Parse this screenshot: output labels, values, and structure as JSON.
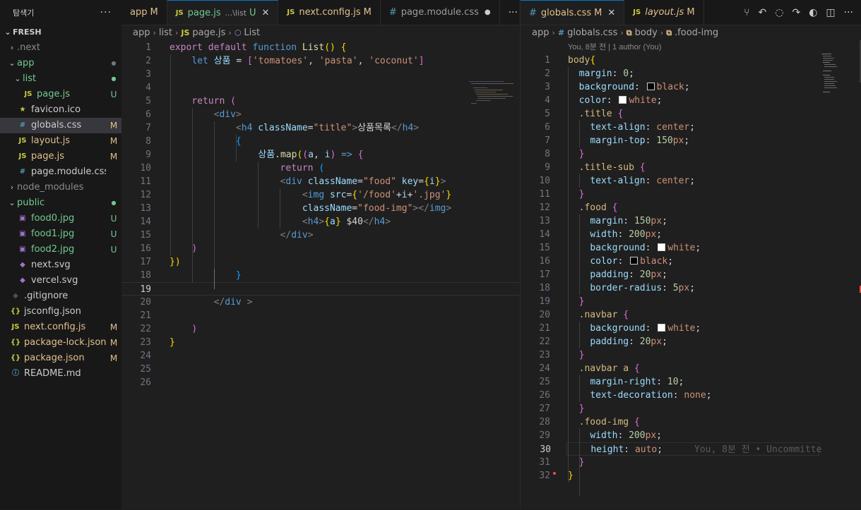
{
  "explorer": {
    "title": "탐색기",
    "more": "···",
    "root": "FRESH",
    "items": [
      {
        "label": ".next",
        "chev": "›",
        "indent": 0,
        "icon": "",
        "iconType": "",
        "status": "",
        "statusType": "dot-grey",
        "color": "grey"
      },
      {
        "label": "app",
        "chev": "⌄",
        "indent": 0,
        "icon": "",
        "iconType": "",
        "status": "●",
        "statusType": "dot-grey",
        "color": "green"
      },
      {
        "label": "list",
        "chev": "⌄",
        "indent": 1,
        "icon": "",
        "iconType": "",
        "status": "●",
        "statusType": "dot-green",
        "color": "green"
      },
      {
        "label": "page.js",
        "chev": "",
        "indent": 2,
        "icon": "JS",
        "iconType": "js",
        "status": "U",
        "statusType": "u",
        "color": "green"
      },
      {
        "label": "favicon.ico",
        "chev": "",
        "indent": 1,
        "icon": "★",
        "iconType": "star",
        "status": "",
        "statusType": "",
        "color": "plain"
      },
      {
        "label": "globals.css",
        "chev": "",
        "indent": 1,
        "icon": "#",
        "iconType": "hash",
        "status": "M",
        "statusType": "m",
        "color": "plain",
        "selected": true
      },
      {
        "label": "layout.js",
        "chev": "",
        "indent": 1,
        "icon": "JS",
        "iconType": "js",
        "status": "M",
        "statusType": "m",
        "color": "yellow"
      },
      {
        "label": "page.js",
        "chev": "",
        "indent": 1,
        "icon": "JS",
        "iconType": "js",
        "status": "M",
        "statusType": "m",
        "color": "yellow"
      },
      {
        "label": "page.module.css",
        "chev": "",
        "indent": 1,
        "icon": "#",
        "iconType": "hash",
        "status": "",
        "statusType": "",
        "color": "plain"
      },
      {
        "label": "node_modules",
        "chev": "›",
        "indent": 0,
        "icon": "",
        "iconType": "",
        "status": "",
        "statusType": "",
        "color": "grey"
      },
      {
        "label": "public",
        "chev": "⌄",
        "indent": 0,
        "icon": "",
        "iconType": "",
        "status": "●",
        "statusType": "dot-green",
        "color": "green"
      },
      {
        "label": "food0.jpg",
        "chev": "",
        "indent": 1,
        "icon": "▣",
        "iconType": "img",
        "status": "U",
        "statusType": "u",
        "color": "green"
      },
      {
        "label": "food1.jpg",
        "chev": "",
        "indent": 1,
        "icon": "▣",
        "iconType": "img",
        "status": "U",
        "statusType": "u",
        "color": "green"
      },
      {
        "label": "food2.jpg",
        "chev": "",
        "indent": 1,
        "icon": "▣",
        "iconType": "img",
        "status": "U",
        "statusType": "u",
        "color": "green"
      },
      {
        "label": "next.svg",
        "chev": "",
        "indent": 1,
        "icon": "◆",
        "iconType": "svg",
        "status": "",
        "statusType": "",
        "color": "plain"
      },
      {
        "label": "vercel.svg",
        "chev": "",
        "indent": 1,
        "icon": "◆",
        "iconType": "svg",
        "status": "",
        "statusType": "",
        "color": "plain"
      },
      {
        "label": ".gitignore",
        "chev": "",
        "indent": 0,
        "icon": "◆",
        "iconType": "git",
        "status": "",
        "statusType": "",
        "color": "plain"
      },
      {
        "label": "jsconfig.json",
        "chev": "",
        "indent": 0,
        "icon": "{}",
        "iconType": "json",
        "status": "",
        "statusType": "",
        "color": "plain"
      },
      {
        "label": "next.config.js",
        "chev": "",
        "indent": 0,
        "icon": "JS",
        "iconType": "js",
        "status": "M",
        "statusType": "m",
        "color": "yellow"
      },
      {
        "label": "package-lock.json",
        "chev": "",
        "indent": 0,
        "icon": "{}",
        "iconType": "json",
        "status": "M",
        "statusType": "m",
        "color": "yellow"
      },
      {
        "label": "package.json",
        "chev": "",
        "indent": 0,
        "icon": "{}",
        "iconType": "json",
        "status": "M",
        "statusType": "m",
        "color": "yellow"
      },
      {
        "label": "README.md",
        "chev": "",
        "indent": 0,
        "icon": "ⓘ",
        "iconType": "info",
        "status": "",
        "statusType": "",
        "color": "plain"
      }
    ]
  },
  "left_editor": {
    "tabs": [
      {
        "label": "app",
        "status": "M",
        "kind": "plain"
      },
      {
        "label": "page.js",
        "sub": "...\\list",
        "status": "U",
        "kind": "js",
        "active": true,
        "close": "✕"
      },
      {
        "label": "next.config.js",
        "status": "M",
        "kind": "js"
      },
      {
        "label": "page.module.css",
        "status": "●",
        "kind": "css"
      }
    ],
    "more": "···",
    "breadcrumb": [
      "app",
      "list",
      "page.js",
      "List"
    ],
    "current_line": 19,
    "line_count": 26
  },
  "right_editor": {
    "tabs": [
      {
        "label": "globals.css",
        "status": "M",
        "kind": "css",
        "active": true,
        "close": "✕"
      },
      {
        "label": "layout.js",
        "status": "M",
        "kind": "js",
        "italic": true
      }
    ],
    "breadcrumb": [
      "app",
      "globals.css",
      "body",
      ".food-img"
    ],
    "blame_header": "You, 8분 전 | 1 author (You)",
    "inline_blame": "You, 8분 전 • Uncommitte",
    "current_line": 30,
    "line_count": 32
  }
}
